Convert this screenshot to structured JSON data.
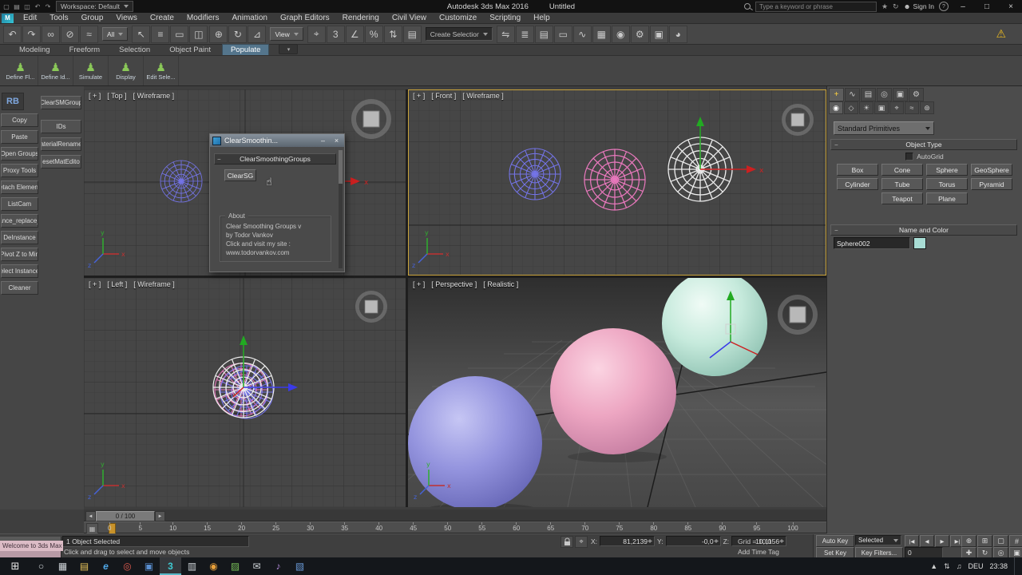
{
  "ui": {
    "collapse": "−"
  },
  "axis": {
    "x": "x",
    "y": "y",
    "z": "z"
  },
  "titlebar": {
    "quick_icons": [
      {
        "name": "new-scene-icon",
        "glyph": "▢"
      },
      {
        "name": "open-file-icon",
        "glyph": "▤"
      },
      {
        "name": "save-file-icon",
        "glyph": "◫"
      },
      {
        "name": "undo-icon",
        "glyph": "↶"
      },
      {
        "name": "redo-icon",
        "glyph": "↷"
      }
    ],
    "workspace": "Workspace: Default",
    "app_title": "Autodesk 3ds Max 2016",
    "doc_title": "Untitled",
    "search_placeholder": "Type a keyword or phrase",
    "star_icon": "★",
    "sync_icon": "↻",
    "person_icon": "☻",
    "sign_in": "Sign In",
    "help_icon": "?",
    "window_minimize": "–",
    "window_maximize": "□",
    "window_close": "×"
  },
  "menubar": {
    "items": [
      "Edit",
      "Tools",
      "Group",
      "Views",
      "Create",
      "Modifiers",
      "Animation",
      "Graph Editors",
      "Rendering",
      "Civil View",
      "Customize",
      "Scripting",
      "Help"
    ]
  },
  "toolbar": {
    "group1": [
      {
        "name": "undo-icon",
        "glyph": "↶"
      },
      {
        "name": "redo-icon",
        "glyph": "↷"
      },
      {
        "name": "select-link-icon",
        "glyph": "∞"
      },
      {
        "name": "unlink-icon",
        "glyph": "⊘"
      },
      {
        "name": "bind-spacewarp-icon",
        "glyph": "≈"
      }
    ],
    "filter_dropdown": "All",
    "group2": [
      {
        "name": "select-object-icon",
        "glyph": "↖"
      },
      {
        "name": "select-by-name-icon",
        "glyph": "≡"
      },
      {
        "name": "rect-select-region-icon",
        "glyph": "▭"
      },
      {
        "name": "window-crossing-icon",
        "glyph": "◫"
      }
    ],
    "group3": [
      {
        "name": "select-move-icon",
        "glyph": "⊕"
      },
      {
        "name": "select-rotate-icon",
        "glyph": "↻"
      },
      {
        "name": "select-scale-icon",
        "glyph": "⊿"
      }
    ],
    "view_dropdown": "View",
    "group4": [
      {
        "name": "use-pivot-icon",
        "glyph": "⌖"
      },
      {
        "name": "snap-toggle-icon",
        "glyph": "3"
      },
      {
        "name": "angle-snap-icon",
        "glyph": "∠"
      },
      {
        "name": "percent-snap-icon",
        "glyph": "%"
      },
      {
        "name": "spinner-snap-icon",
        "glyph": "⇅"
      },
      {
        "name": "edit-named-selections-icon",
        "glyph": "▤"
      }
    ],
    "selection_set_dropdown": "Create Selection Se",
    "group5": [
      {
        "name": "mirror-icon",
        "glyph": "⇋"
      },
      {
        "name": "align-icon",
        "glyph": "≣"
      },
      {
        "name": "layer-manager-icon",
        "glyph": "▤"
      },
      {
        "name": "graphite-ribbon-icon",
        "glyph": "▭"
      },
      {
        "name": "curve-editor-icon",
        "glyph": "∿"
      },
      {
        "name": "schematic-view-icon",
        "glyph": "▦"
      },
      {
        "name": "material-editor-icon",
        "glyph": "◉"
      },
      {
        "name": "render-setup-icon",
        "glyph": "⚙"
      },
      {
        "name": "rendered-frame-icon",
        "glyph": "▣"
      },
      {
        "name": "render-icon",
        "glyph": "◕"
      }
    ],
    "warning_icon": "⚠"
  },
  "ribbon": {
    "tabs": [
      "Modeling",
      "Freeform",
      "Selection",
      "Object Paint",
      "Populate"
    ],
    "collapse_icon": "▾",
    "tools": [
      {
        "icon": "♟",
        "label": "Define Fl..."
      },
      {
        "icon": "♟",
        "label": "Define Id..."
      },
      {
        "icon": "♟",
        "label": "Simulate"
      },
      {
        "icon": "♟",
        "label": "Display"
      },
      {
        "icon": "♟",
        "label": "Edit Sele..."
      }
    ]
  },
  "left_toolbar": {
    "logo": "RB",
    "col1": [
      "Copy",
      "Paste",
      "Open Groups",
      "Proxy Tools",
      "etach Element",
      "ListCam",
      "ance_replace_",
      "DeInstance",
      "Pivot Z to Min",
      "elect Instance",
      "Cleaner"
    ],
    "col2": [
      "ClearSMGroup",
      "IDs",
      "aterialRename",
      "esetMatEdito"
    ]
  },
  "viewports": {
    "top": {
      "plus": "[ + ]",
      "view": "[ Top ]",
      "shading": "[ Wireframe ]"
    },
    "front": {
      "plus": "[ + ]",
      "view": "[ Front ]",
      "shading": "[ Wireframe ]"
    },
    "left": {
      "plus": "[ + ]",
      "view": "[ Left ]",
      "shading": "[ Wireframe ]"
    },
    "perspective": {
      "plus": "[ + ]",
      "view": "[ Perspective ]",
      "shading": "[ Realistic ]"
    }
  },
  "dialog": {
    "title": "ClearSmoothin...",
    "minimize": "–",
    "close": "×",
    "rollout": "ClearSmoothingGroups",
    "clear_button": "ClearSG",
    "about_label": "About",
    "line1": "Clear Smoothing Groups v",
    "line2": "by Todor Vankov",
    "line3": "Click and visit my site :",
    "link": "www.todorvankov.com",
    "cursor": "☝"
  },
  "command_panel": {
    "tabs": [
      {
        "name": "create-tab-icon",
        "glyph": "+"
      },
      {
        "name": "modify-tab-icon",
        "glyph": "∿"
      },
      {
        "name": "hierarchy-tab-icon",
        "glyph": "▤"
      },
      {
        "name": "motion-tab-icon",
        "glyph": "◎"
      },
      {
        "name": "display-tab-icon",
        "glyph": "▣"
      },
      {
        "name": "utilities-tab-icon",
        "glyph": "⚙"
      }
    ],
    "categories": [
      {
        "name": "geometry-category-icon",
        "glyph": "◉"
      },
      {
        "name": "shapes-category-icon",
        "glyph": "◇"
      },
      {
        "name": "lights-category-icon",
        "glyph": "☀"
      },
      {
        "name": "cameras-category-icon",
        "glyph": "▣"
      },
      {
        "name": "helpers-category-icon",
        "glyph": "⌖"
      },
      {
        "name": "spacewarps-category-icon",
        "glyph": "≈"
      },
      {
        "name": "systems-category-icon",
        "glyph": "⊛"
      }
    ],
    "category_dropdown": "Standard Primitives",
    "object_type_rollout": "Object Type",
    "autogrid": "AutoGrid",
    "object_buttons": [
      "Box",
      "Cone",
      "Sphere",
      "GeoSphere",
      "Cylinder",
      "Tube",
      "Torus",
      "Pyramid",
      "Teapot",
      "Plane"
    ],
    "name_color_rollout": "Name and Color",
    "object_name": "Sphere002",
    "object_color": "#a8dcd4"
  },
  "timeline": {
    "left_arrow": "◄",
    "thumb": "0 / 100",
    "right_arrow": "►",
    "trackbar_icon": "▦",
    "ticks": [
      "0",
      "5",
      "10",
      "15",
      "20",
      "25",
      "30",
      "35",
      "40",
      "45",
      "50",
      "55",
      "60",
      "65",
      "70",
      "75",
      "80",
      "85",
      "90",
      "95",
      "100"
    ]
  },
  "statusbar": {
    "selection_info": "1 Object Selected",
    "prompt": "Click and drag to select and move objects",
    "mode_icon": "⌖",
    "x_label": "X:",
    "x_value": "81,2139",
    "y_label": "Y:",
    "y_value": "-0,0",
    "z_label": "Z:",
    "z_value": "10,1156",
    "grid_info": "Grid = 10,0",
    "add_time_tag": "Add Time Tag",
    "auto_key": "Auto Key",
    "set_key": "Set Key",
    "key_mode": "Selected",
    "key_filters": "Key Filters...",
    "transport": [
      {
        "name": "go-to-start-button",
        "glyph": "|◀"
      },
      {
        "name": "previous-frame-button",
        "glyph": "◀"
      },
      {
        "name": "play-button",
        "glyph": "▶"
      },
      {
        "name": "go-to-end-button",
        "glyph": "▶|"
      }
    ],
    "frame": "0",
    "nav1": [
      {
        "name": "zoom-icon",
        "glyph": "⊕"
      },
      {
        "name": "zoom-all-icon",
        "glyph": "⊞"
      },
      {
        "name": "zoom-extents-icon",
        "glyph": "▢"
      },
      {
        "name": "zoom-region-icon",
        "glyph": "#"
      }
    ],
    "nav2": [
      {
        "name": "pan-icon",
        "glyph": "✚"
      },
      {
        "name": "orbit-icon",
        "glyph": "↻"
      },
      {
        "name": "fov-icon",
        "glyph": "◎"
      },
      {
        "name": "maximize-viewport-icon",
        "glyph": "▣"
      }
    ]
  },
  "welcome": {
    "title": "Welcome to 3ds Max"
  },
  "taskbar": {
    "start_icon": "⊞",
    "apps": [
      {
        "name": "search-icon",
        "glyph": "○"
      },
      {
        "name": "task-view-icon",
        "glyph": "▦"
      },
      {
        "name": "file-explorer-icon",
        "glyph": "▤"
      },
      {
        "name": "browser-icon",
        "glyph": "e"
      },
      {
        "name": "app-icon",
        "glyph": "◎"
      },
      {
        "name": "app-icon",
        "glyph": "▣"
      },
      {
        "name": "3ds-max-icon",
        "glyph": "3"
      },
      {
        "name": "app-icon",
        "glyph": "▥"
      },
      {
        "name": "app-icon",
        "glyph": "◉"
      },
      {
        "name": "app-icon",
        "glyph": "▨"
      },
      {
        "name": "mail-icon",
        "glyph": "✉"
      },
      {
        "name": "media-icon",
        "glyph": "♪"
      },
      {
        "name": "app-icon",
        "glyph": "▧"
      }
    ],
    "tray_up_icon": "▲",
    "network_icon": "⇅",
    "volume_icon": "♫",
    "language": "DEU",
    "time": "23:38"
  }
}
